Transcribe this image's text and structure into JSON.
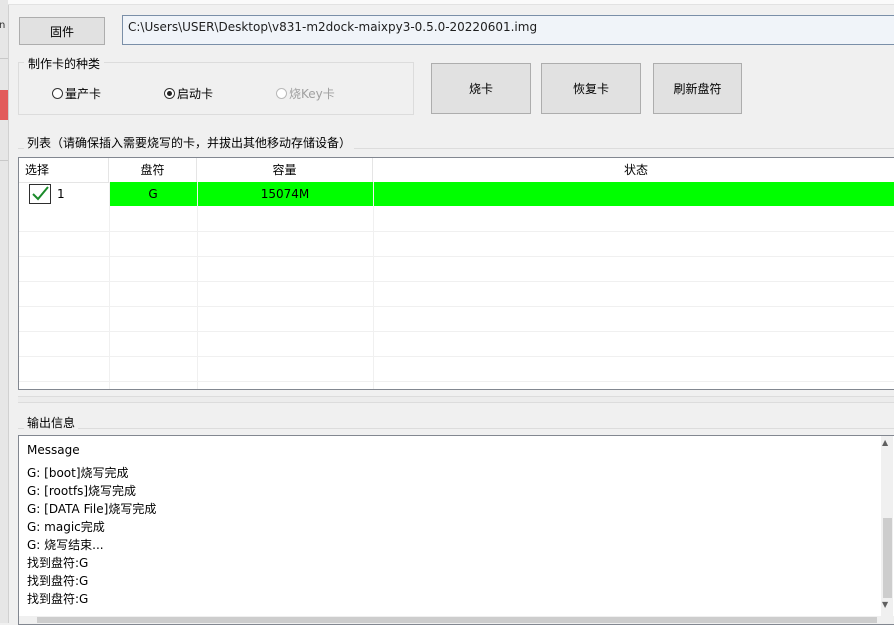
{
  "firmware": {
    "button_label": "固件",
    "path_value": "C:\\Users\\USER\\Desktop\\v831-m2dock-maixpy3-0.5.0-20220601.img"
  },
  "card_type": {
    "title": "制作卡的种类",
    "options": [
      {
        "label": "量产卡",
        "selected": false,
        "enabled": true
      },
      {
        "label": "启动卡",
        "selected": true,
        "enabled": true
      },
      {
        "label": "烧Key卡",
        "selected": false,
        "enabled": false
      }
    ]
  },
  "actions": {
    "burn": "烧卡",
    "restore": "恢复卡",
    "refresh": "刷新盘符"
  },
  "list": {
    "title": "列表（请确保插入需要烧写的卡，并拔出其他移动存储设备）",
    "headers": {
      "select": "选择",
      "drive": "盘符",
      "capacity": "容量",
      "status": "状态"
    },
    "rows": [
      {
        "index": "1",
        "checked": true,
        "drive": "G",
        "capacity": "15074M",
        "status": "",
        "highlight": "#00ff00"
      }
    ]
  },
  "output": {
    "title": "输出信息",
    "lines": [
      "Message",
      "G: [boot]烧写完成",
      "G: [rootfs]烧写完成",
      "G: [DATA File]烧写完成",
      "G: magic完成",
      "G: 烧写结束...",
      "找到盘符:G",
      "找到盘符:G",
      "找到盘符:G"
    ]
  },
  "colors": {
    "ok_row": "#00ff00",
    "checkmark": "#1a8a2a"
  }
}
